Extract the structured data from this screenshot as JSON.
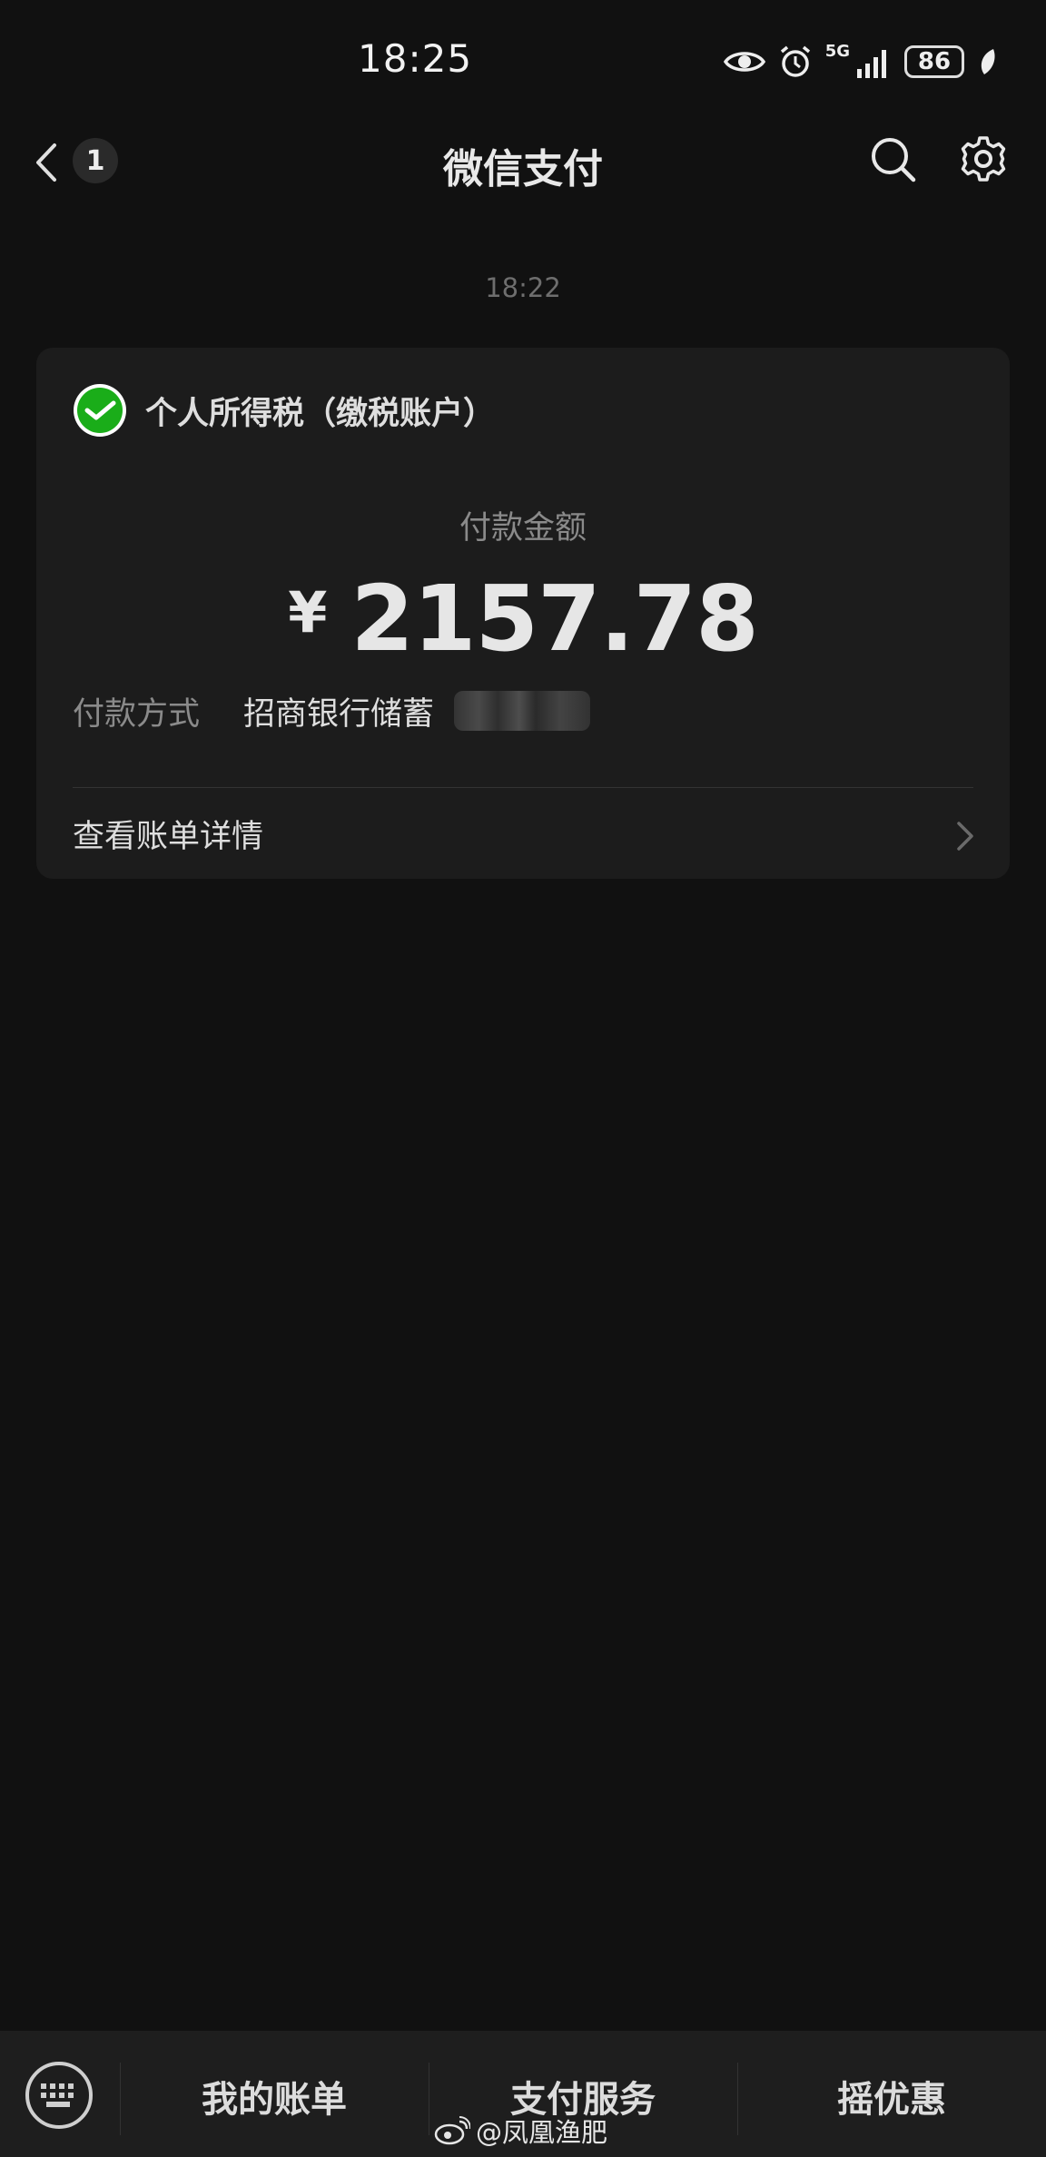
{
  "status_bar": {
    "time": "18:25",
    "network": "5G",
    "battery": "86",
    "icons": [
      "eye-icon",
      "alarm-icon",
      "signal-icon",
      "battery-icon",
      "leaf-icon"
    ]
  },
  "nav": {
    "title": "微信支付",
    "back_badge": "1"
  },
  "message": {
    "timestamp": "18:22"
  },
  "card": {
    "merchant": "个人所得税（缴税账户）",
    "amount_label": "付款金额",
    "currency": "¥",
    "amount": "2157.78",
    "pay_method_label": "付款方式",
    "pay_method_value": "招商银行储蓄",
    "details_label": "查看账单详情"
  },
  "bottom_bar": {
    "tabs": [
      "我的账单",
      "支付服务",
      "摇优惠"
    ]
  },
  "watermark": {
    "text": "@凤凰渔肥"
  },
  "colors": {
    "background": "#111111",
    "card": "#1c1c1c",
    "wechat_green": "#1aad19"
  }
}
